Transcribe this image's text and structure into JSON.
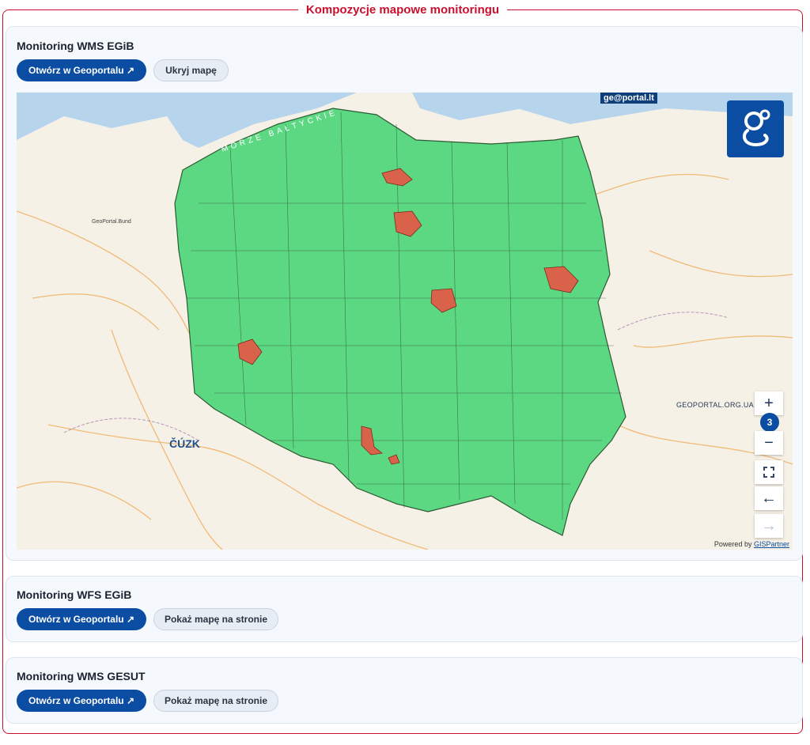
{
  "section": {
    "title": "Kompozycje mapowe monitoringu"
  },
  "cards": [
    {
      "title": "Monitoring WMS EGiB",
      "open_label": "Otwórz w Geoportalu ↗",
      "toggle_label": "Ukryj mapę"
    },
    {
      "title": "Monitoring WFS EGiB",
      "open_label": "Otwórz w Geoportalu ↗",
      "toggle_label": "Pokaż mapę na stronie"
    },
    {
      "title": "Monitoring WMS GESUT",
      "open_label": "Otwórz w Geoportalu ↗",
      "toggle_label": "Pokaż mapę na stronie"
    }
  ],
  "map": {
    "sea_label": "MORZE BAŁTYCKIE",
    "zoom_level": "3",
    "zoom_in": "+",
    "zoom_out": "−",
    "fullscreen_icon": "fullscreen-icon",
    "back_icon": "←",
    "forward_icon": "→",
    "credit_prefix": "Powered by",
    "credit_link": "GISPartner",
    "geoportal_lt": "ge@portal.lt",
    "geoportal_ua": "GEOPORTAL.ORG.UA",
    "geoportal_de": "GeoPortal.Bund",
    "cuzk": "ČÚZK",
    "colors": {
      "compliant": "#5cd882",
      "noncompliant": "#d9624a",
      "sea": "#b6d4ec",
      "land": "#f6f1e7"
    }
  }
}
